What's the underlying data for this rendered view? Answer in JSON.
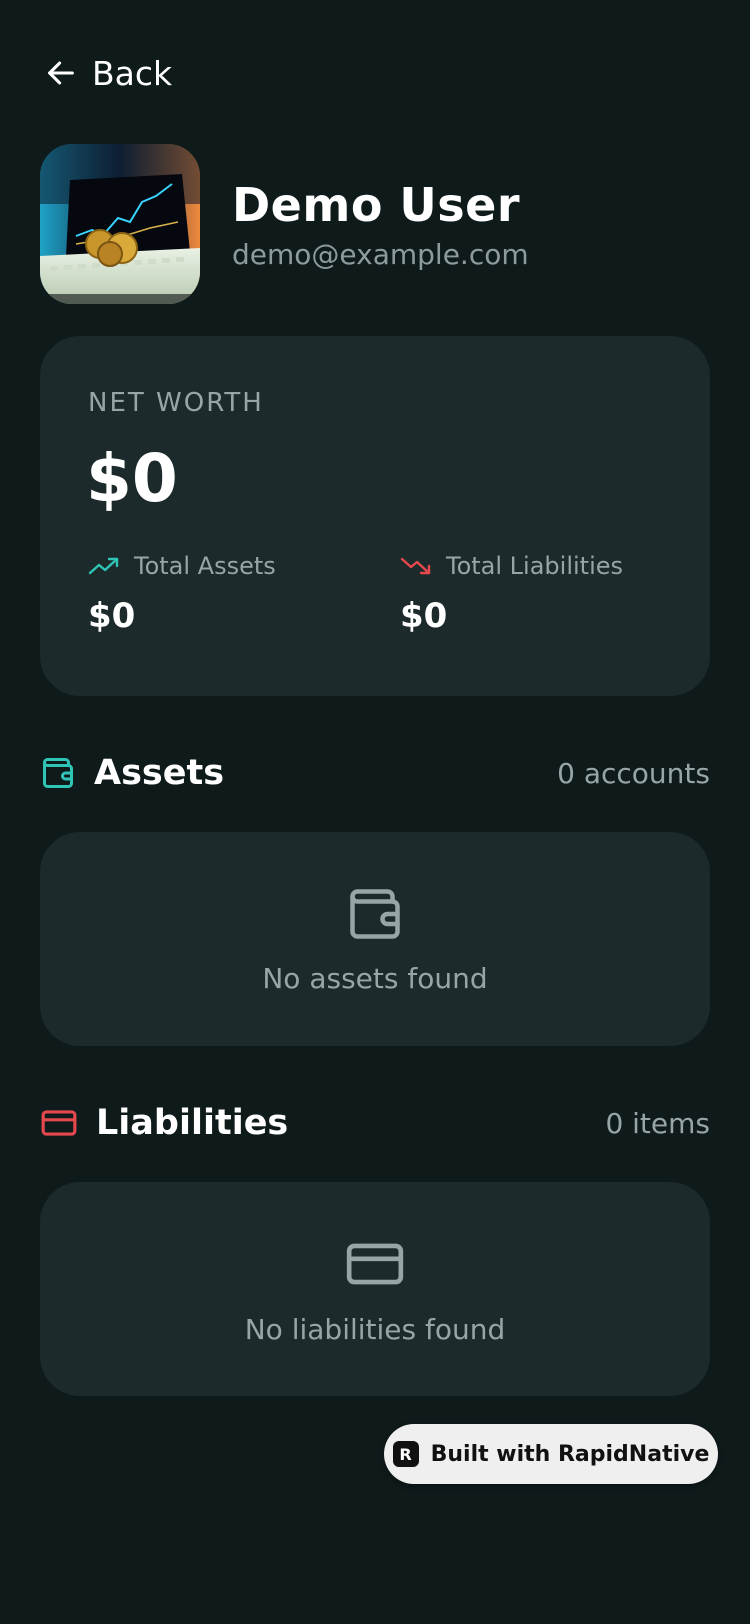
{
  "nav": {
    "back_label": "Back"
  },
  "profile": {
    "name": "Demo User",
    "email": "demo@example.com"
  },
  "net_worth": {
    "label": "NET WORTH",
    "value": "$0",
    "assets_label": "Total Assets",
    "assets_value": "$0",
    "liabilities_label": "Total Liabilities",
    "liabilities_value": "$0"
  },
  "assets": {
    "title": "Assets",
    "count": "0 accounts",
    "empty_text": "No assets found"
  },
  "liabilities": {
    "title": "Liabilities",
    "count": "0 items",
    "empty_text": "No liabilities found"
  },
  "badge": {
    "logo": "R",
    "text": "Built with RapidNative"
  },
  "colors": {
    "background": "#0f1a1b",
    "card": "#1c2a2b",
    "asset_accent": "#2ec4b6",
    "liability_accent": "#e5484d",
    "muted_text": "#98a5a7"
  },
  "icons": {
    "back": "arrow-left-icon",
    "assets_trend": "trending-up-icon",
    "liabilities_trend": "trending-down-icon",
    "assets": "wallet-icon",
    "liabilities": "credit-card-icon"
  }
}
